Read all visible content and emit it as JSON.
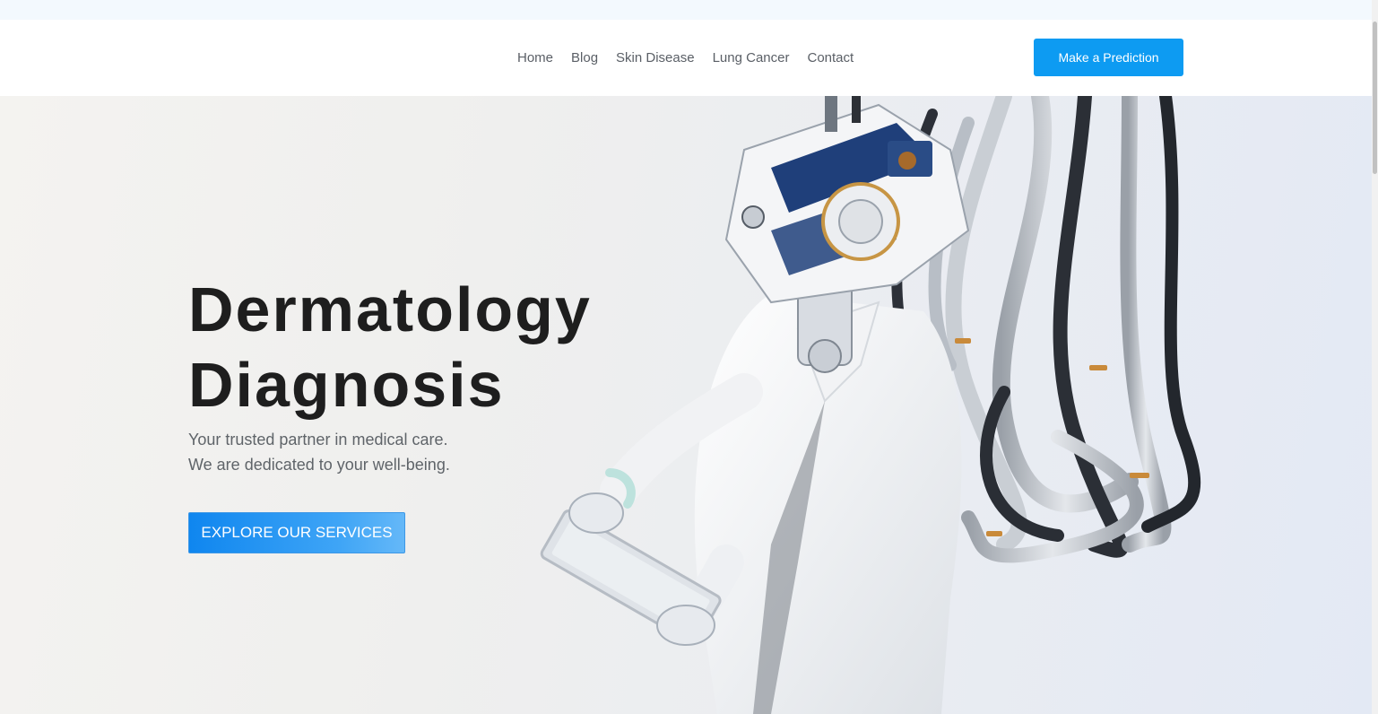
{
  "nav": {
    "links": [
      "Home",
      "Blog",
      "Skin Disease",
      "Lung Cancer",
      "Contact"
    ],
    "cta_label": "Make a Prediction"
  },
  "hero": {
    "title_line1": "Dermatology",
    "title_line2": "Diagnosis",
    "subtitle_line1": "Your trusted partner in medical care.",
    "subtitle_line2": "We are dedicated to your well-being.",
    "button_label": "EXPLORE OUR SERVICES",
    "image": "robot-doctor-illustration"
  },
  "colors": {
    "accent": "#0d9bf2",
    "hero_button": "#0f86ef",
    "title_text": "#1e1e1e",
    "nav_text": "#5a5f66"
  }
}
